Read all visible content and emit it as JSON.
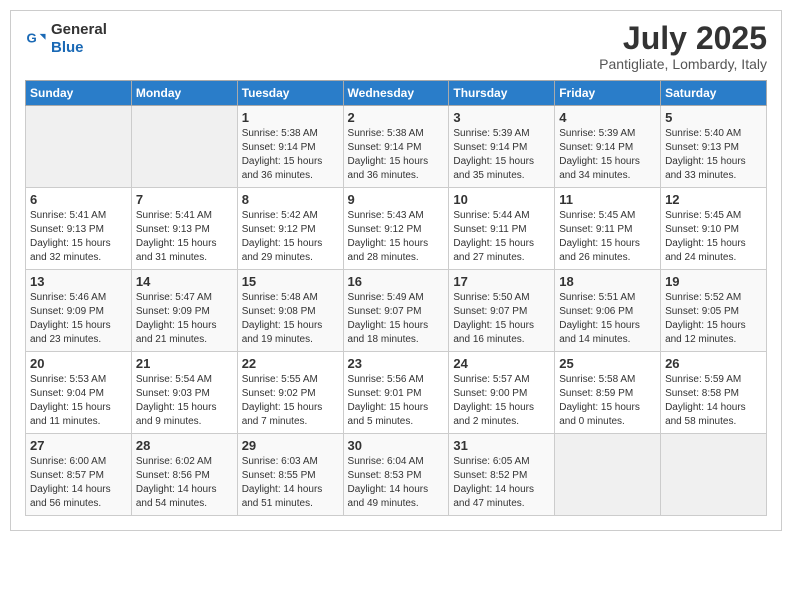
{
  "logo": {
    "general": "General",
    "blue": "Blue"
  },
  "header": {
    "title": "July 2025",
    "subtitle": "Pantigliate, Lombardy, Italy"
  },
  "weekdays": [
    "Sunday",
    "Monday",
    "Tuesday",
    "Wednesday",
    "Thursday",
    "Friday",
    "Saturday"
  ],
  "weeks": [
    [
      {
        "day": "",
        "info": ""
      },
      {
        "day": "",
        "info": ""
      },
      {
        "day": "1",
        "info": "Sunrise: 5:38 AM\nSunset: 9:14 PM\nDaylight: 15 hours and 36 minutes."
      },
      {
        "day": "2",
        "info": "Sunrise: 5:38 AM\nSunset: 9:14 PM\nDaylight: 15 hours and 36 minutes."
      },
      {
        "day": "3",
        "info": "Sunrise: 5:39 AM\nSunset: 9:14 PM\nDaylight: 15 hours and 35 minutes."
      },
      {
        "day": "4",
        "info": "Sunrise: 5:39 AM\nSunset: 9:14 PM\nDaylight: 15 hours and 34 minutes."
      },
      {
        "day": "5",
        "info": "Sunrise: 5:40 AM\nSunset: 9:13 PM\nDaylight: 15 hours and 33 minutes."
      }
    ],
    [
      {
        "day": "6",
        "info": "Sunrise: 5:41 AM\nSunset: 9:13 PM\nDaylight: 15 hours and 32 minutes."
      },
      {
        "day": "7",
        "info": "Sunrise: 5:41 AM\nSunset: 9:13 PM\nDaylight: 15 hours and 31 minutes."
      },
      {
        "day": "8",
        "info": "Sunrise: 5:42 AM\nSunset: 9:12 PM\nDaylight: 15 hours and 29 minutes."
      },
      {
        "day": "9",
        "info": "Sunrise: 5:43 AM\nSunset: 9:12 PM\nDaylight: 15 hours and 28 minutes."
      },
      {
        "day": "10",
        "info": "Sunrise: 5:44 AM\nSunset: 9:11 PM\nDaylight: 15 hours and 27 minutes."
      },
      {
        "day": "11",
        "info": "Sunrise: 5:45 AM\nSunset: 9:11 PM\nDaylight: 15 hours and 26 minutes."
      },
      {
        "day": "12",
        "info": "Sunrise: 5:45 AM\nSunset: 9:10 PM\nDaylight: 15 hours and 24 minutes."
      }
    ],
    [
      {
        "day": "13",
        "info": "Sunrise: 5:46 AM\nSunset: 9:09 PM\nDaylight: 15 hours and 23 minutes."
      },
      {
        "day": "14",
        "info": "Sunrise: 5:47 AM\nSunset: 9:09 PM\nDaylight: 15 hours and 21 minutes."
      },
      {
        "day": "15",
        "info": "Sunrise: 5:48 AM\nSunset: 9:08 PM\nDaylight: 15 hours and 19 minutes."
      },
      {
        "day": "16",
        "info": "Sunrise: 5:49 AM\nSunset: 9:07 PM\nDaylight: 15 hours and 18 minutes."
      },
      {
        "day": "17",
        "info": "Sunrise: 5:50 AM\nSunset: 9:07 PM\nDaylight: 15 hours and 16 minutes."
      },
      {
        "day": "18",
        "info": "Sunrise: 5:51 AM\nSunset: 9:06 PM\nDaylight: 15 hours and 14 minutes."
      },
      {
        "day": "19",
        "info": "Sunrise: 5:52 AM\nSunset: 9:05 PM\nDaylight: 15 hours and 12 minutes."
      }
    ],
    [
      {
        "day": "20",
        "info": "Sunrise: 5:53 AM\nSunset: 9:04 PM\nDaylight: 15 hours and 11 minutes."
      },
      {
        "day": "21",
        "info": "Sunrise: 5:54 AM\nSunset: 9:03 PM\nDaylight: 15 hours and 9 minutes."
      },
      {
        "day": "22",
        "info": "Sunrise: 5:55 AM\nSunset: 9:02 PM\nDaylight: 15 hours and 7 minutes."
      },
      {
        "day": "23",
        "info": "Sunrise: 5:56 AM\nSunset: 9:01 PM\nDaylight: 15 hours and 5 minutes."
      },
      {
        "day": "24",
        "info": "Sunrise: 5:57 AM\nSunset: 9:00 PM\nDaylight: 15 hours and 2 minutes."
      },
      {
        "day": "25",
        "info": "Sunrise: 5:58 AM\nSunset: 8:59 PM\nDaylight: 15 hours and 0 minutes."
      },
      {
        "day": "26",
        "info": "Sunrise: 5:59 AM\nSunset: 8:58 PM\nDaylight: 14 hours and 58 minutes."
      }
    ],
    [
      {
        "day": "27",
        "info": "Sunrise: 6:00 AM\nSunset: 8:57 PM\nDaylight: 14 hours and 56 minutes."
      },
      {
        "day": "28",
        "info": "Sunrise: 6:02 AM\nSunset: 8:56 PM\nDaylight: 14 hours and 54 minutes."
      },
      {
        "day": "29",
        "info": "Sunrise: 6:03 AM\nSunset: 8:55 PM\nDaylight: 14 hours and 51 minutes."
      },
      {
        "day": "30",
        "info": "Sunrise: 6:04 AM\nSunset: 8:53 PM\nDaylight: 14 hours and 49 minutes."
      },
      {
        "day": "31",
        "info": "Sunrise: 6:05 AM\nSunset: 8:52 PM\nDaylight: 14 hours and 47 minutes."
      },
      {
        "day": "",
        "info": ""
      },
      {
        "day": "",
        "info": ""
      }
    ]
  ]
}
